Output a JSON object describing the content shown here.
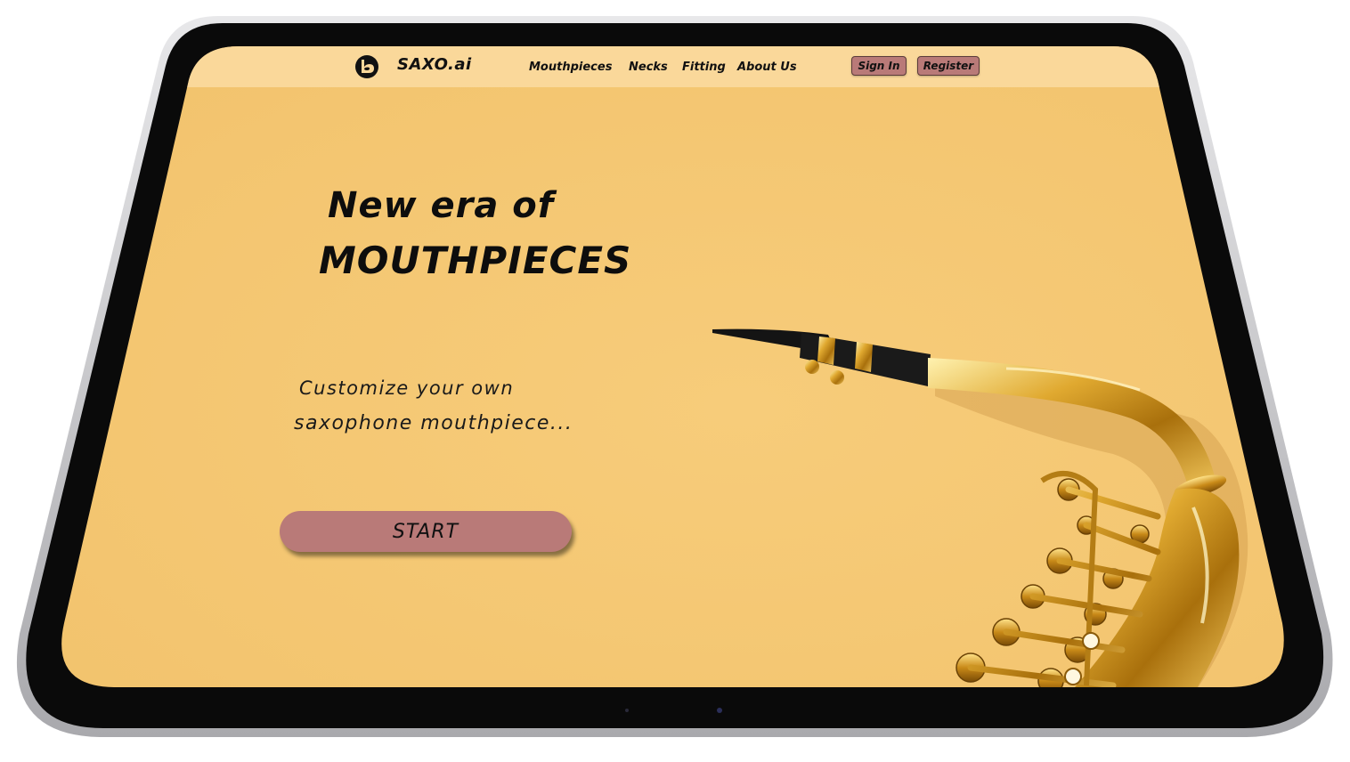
{
  "header": {
    "brand": "SAXO.ai",
    "nav": [
      {
        "label": "Mouthpieces"
      },
      {
        "label": "Necks"
      },
      {
        "label": "Fitting"
      },
      {
        "label": "About Us"
      }
    ],
    "sign_in_label": "Sign In",
    "register_label": "Register"
  },
  "hero": {
    "title_line1": "New era of",
    "title_line2": "MOUTHPIECES",
    "subtitle_line1": "Customize your own",
    "subtitle_line2": "saxophone mouthpiece...",
    "cta_label": "START"
  },
  "colors": {
    "page_background": "#f5c873",
    "header_background": "#fad89a",
    "button_background": "#b97a78",
    "device_frame": "#0a0a0a",
    "device_edge": "#c9c9cc"
  },
  "icons": {
    "logo": "saxo-logo-icon",
    "hero_image": "saxophone-image"
  }
}
